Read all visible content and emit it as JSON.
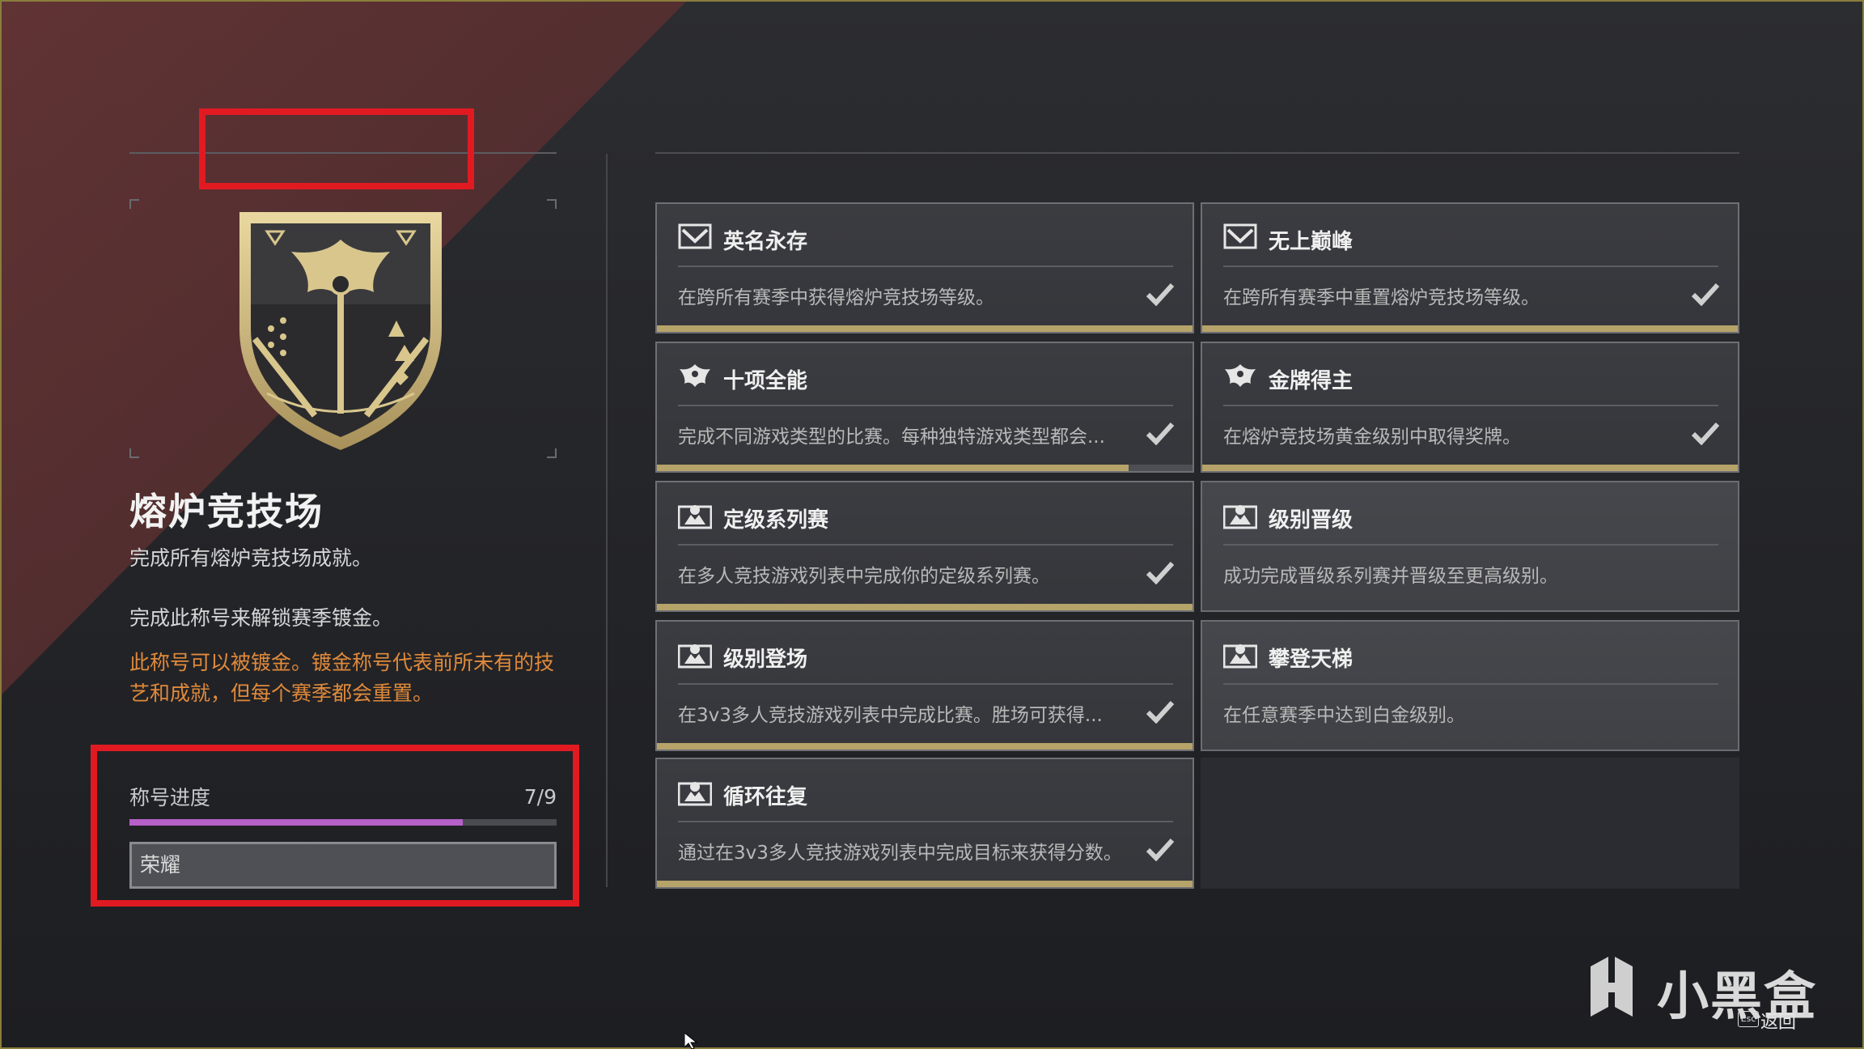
{
  "title": {
    "name": "熔炉竞技场",
    "description": "完成所有熔炉竞技场成就。",
    "gild_info": "完成此称号来解锁赛季镀金。",
    "gild_note": "此称号可以被镀金。镀金称号代表前所未有的技艺和成就，但每个赛季都会重置。"
  },
  "progress": {
    "label": "称号进度",
    "count": "7/9",
    "fraction": 0.78,
    "input_value": "荣耀"
  },
  "triumphs": [
    {
      "name": "英名永存",
      "desc": "在跨所有赛季中获得熔炉竞技场等级。",
      "icon": "chevron-emblem-icon",
      "complete": true,
      "progress": 1.0
    },
    {
      "name": "无上巅峰",
      "desc": "在跨所有赛季中重置熔炉竞技场等级。",
      "icon": "chevron-emblem-icon",
      "complete": true,
      "progress": 1.0
    },
    {
      "name": "十项全能",
      "desc": "完成不同游戏类型的比赛。每种独特游戏类型都会...",
      "icon": "eagle-icon",
      "complete": true,
      "progress": 0.88
    },
    {
      "name": "金牌得主",
      "desc": "在熔炉竞技场黄金级别中取得奖牌。",
      "icon": "eagle-icon",
      "complete": true,
      "progress": 1.0
    },
    {
      "name": "定级系列赛",
      "desc": "在多人竞技游戏列表中完成你的定级系列赛。",
      "icon": "competitive-icon",
      "complete": true,
      "progress": 1.0
    },
    {
      "name": "级别晋级",
      "desc": "成功完成晋级系列赛并晋级至更高级别。",
      "icon": "competitive-icon",
      "complete": false,
      "progress": 0
    },
    {
      "name": "级别登场",
      "desc": "在3v3多人竞技游戏列表中完成比赛。胜场可获得...",
      "icon": "competitive-icon",
      "complete": true,
      "progress": 1.0
    },
    {
      "name": "攀登天梯",
      "desc": "在任意赛季中达到白金级别。",
      "icon": "competitive-icon",
      "complete": false,
      "progress": 0
    },
    {
      "name": "循环往复",
      "desc": "通过在3v3多人竞技游戏列表中完成目标来获得分数。",
      "icon": "competitive-icon",
      "complete": true,
      "progress": 1.0
    }
  ],
  "watermark": {
    "text": "小黑盒",
    "back_key": "Esc",
    "back_label": "返回"
  },
  "colors": {
    "accent_gold": "#b6a36a",
    "progress_purple": "#b660c9",
    "gild_orange": "#e08a3a",
    "highlight_red": "#e11a22"
  }
}
